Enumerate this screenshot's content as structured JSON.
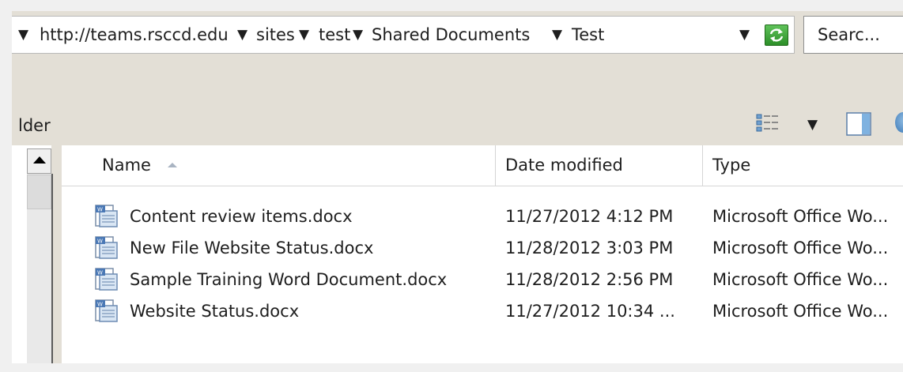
{
  "address": {
    "crumbs": [
      "http://teams.rsccd.edu",
      "sites",
      "test",
      "Shared Documents",
      "Test"
    ],
    "go_icon": "refresh-go-icon"
  },
  "search": {
    "placeholder": "Searc..."
  },
  "toolbar": {
    "partial_label": "lder",
    "views_icon": "details-view-icon",
    "pane_icon": "preview-pane-icon"
  },
  "columns": {
    "name": "Name",
    "date": "Date modified",
    "type": "Type"
  },
  "files": [
    {
      "name": "Content review items.docx",
      "date": "11/27/2012 4:12 PM",
      "type": "Microsoft Office Wo..."
    },
    {
      "name": "New File Website Status.docx",
      "date": "11/28/2012 3:03 PM",
      "type": "Microsoft Office Wo..."
    },
    {
      "name": "Sample Training Word Document.docx",
      "date": "11/28/2012 2:56 PM",
      "type": "Microsoft Office Wo..."
    },
    {
      "name": "Website Status.docx",
      "date": "11/27/2012 10:34 ...",
      "type": "Microsoft Office Wo..."
    }
  ]
}
